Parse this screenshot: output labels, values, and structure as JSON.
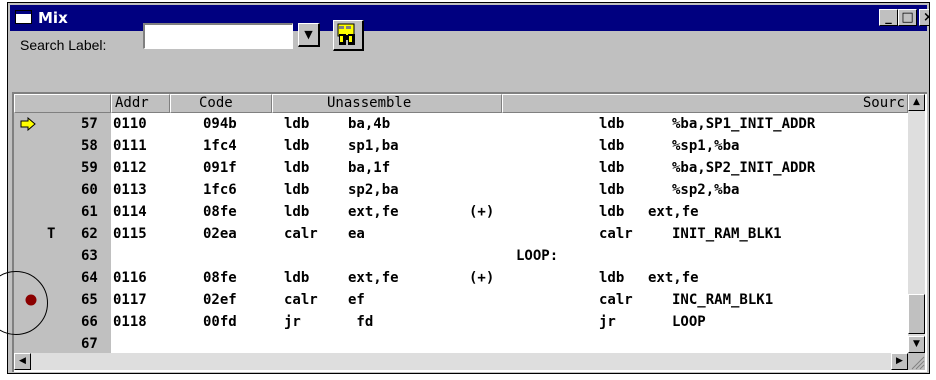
{
  "window": {
    "title": "Mix",
    "minimize_label": "_",
    "maximize_label": "□",
    "close_label": "×"
  },
  "search": {
    "label": "Search Label:",
    "value": "",
    "dropdown_glyph": "▼"
  },
  "columns": {
    "addr": "Addr",
    "code": "Code",
    "unassemble": "Unassemble",
    "source": "Sourc"
  },
  "rows": [
    {
      "marker": "arrow",
      "line": "57",
      "addr": "0110",
      "code": "094b",
      "op": "ldb",
      "operand": "ba,4b",
      "extra": "",
      "label": "",
      "src_op": "ldb",
      "src_arg": "%ba,SP1_INIT_ADDR",
      "src_wide": false
    },
    {
      "marker": "",
      "line": "58",
      "addr": "0111",
      "code": "1fc4",
      "op": "ldb",
      "operand": "sp1,ba",
      "extra": "",
      "label": "",
      "src_op": "ldb",
      "src_arg": "%sp1,%ba",
      "src_wide": false
    },
    {
      "marker": "",
      "line": "59",
      "addr": "0112",
      "code": "091f",
      "op": "ldb",
      "operand": "ba,1f",
      "extra": "",
      "label": "",
      "src_op": "ldb",
      "src_arg": "%ba,SP2_INIT_ADDR",
      "src_wide": false
    },
    {
      "marker": "",
      "line": "60",
      "addr": "0113",
      "code": "1fc6",
      "op": "ldb",
      "operand": "sp2,ba",
      "extra": "",
      "label": "",
      "src_op": "ldb",
      "src_arg": "%sp2,%ba",
      "src_wide": false
    },
    {
      "marker": "",
      "line": "61",
      "addr": "0114",
      "code": "08fe",
      "op": "ldb",
      "operand": "ext,fe",
      "extra": "(+)",
      "label": "",
      "src_op": "ldb",
      "src_arg": "ext,fe",
      "src_wide": true
    },
    {
      "marker": "T",
      "line": "62",
      "addr": "0115",
      "code": "02ea",
      "op": "calr",
      "operand": "ea",
      "extra": "",
      "label": "",
      "src_op": "calr",
      "src_arg": "INIT_RAM_BLK1",
      "src_wide": false
    },
    {
      "marker": "",
      "line": "63",
      "addr": "",
      "code": "",
      "op": "",
      "operand": "",
      "extra": "",
      "label": "LOOP:",
      "src_op": "",
      "src_arg": "",
      "src_wide": false
    },
    {
      "marker": "",
      "line": "64",
      "addr": "0116",
      "code": "08fe",
      "op": "ldb",
      "operand": "ext,fe",
      "extra": "(+)",
      "label": "",
      "src_op": "ldb",
      "src_arg": "ext,fe",
      "src_wide": true
    },
    {
      "marker": "breakpoint",
      "line": "65",
      "addr": "0117",
      "code": "02ef",
      "op": "calr",
      "operand": "ef",
      "extra": "",
      "label": "",
      "src_op": "calr",
      "src_arg": "INC_RAM_BLK1",
      "src_wide": false
    },
    {
      "marker": "",
      "line": "66",
      "addr": "0118",
      "code": "00fd",
      "op": "jr",
      "operand": " fd",
      "extra": "",
      "label": "",
      "src_op": "jr",
      "src_arg": "LOOP",
      "src_wide": false
    },
    {
      "marker": "",
      "line": "67",
      "addr": "",
      "code": "",
      "op": "",
      "operand": "",
      "extra": "",
      "label": "",
      "src_op": "",
      "src_arg": "",
      "src_wide": false
    }
  ],
  "colors": {
    "title_bar": "#000080",
    "chrome": "#c0c0c0",
    "arrow_fill": "#ffff00",
    "breakpoint": "#8b0000"
  },
  "icons": {
    "search_button": "binoculars-icon",
    "current_line": "arrow-icon",
    "breakpoint": "breakpoint-icon",
    "window": "window-icon"
  }
}
